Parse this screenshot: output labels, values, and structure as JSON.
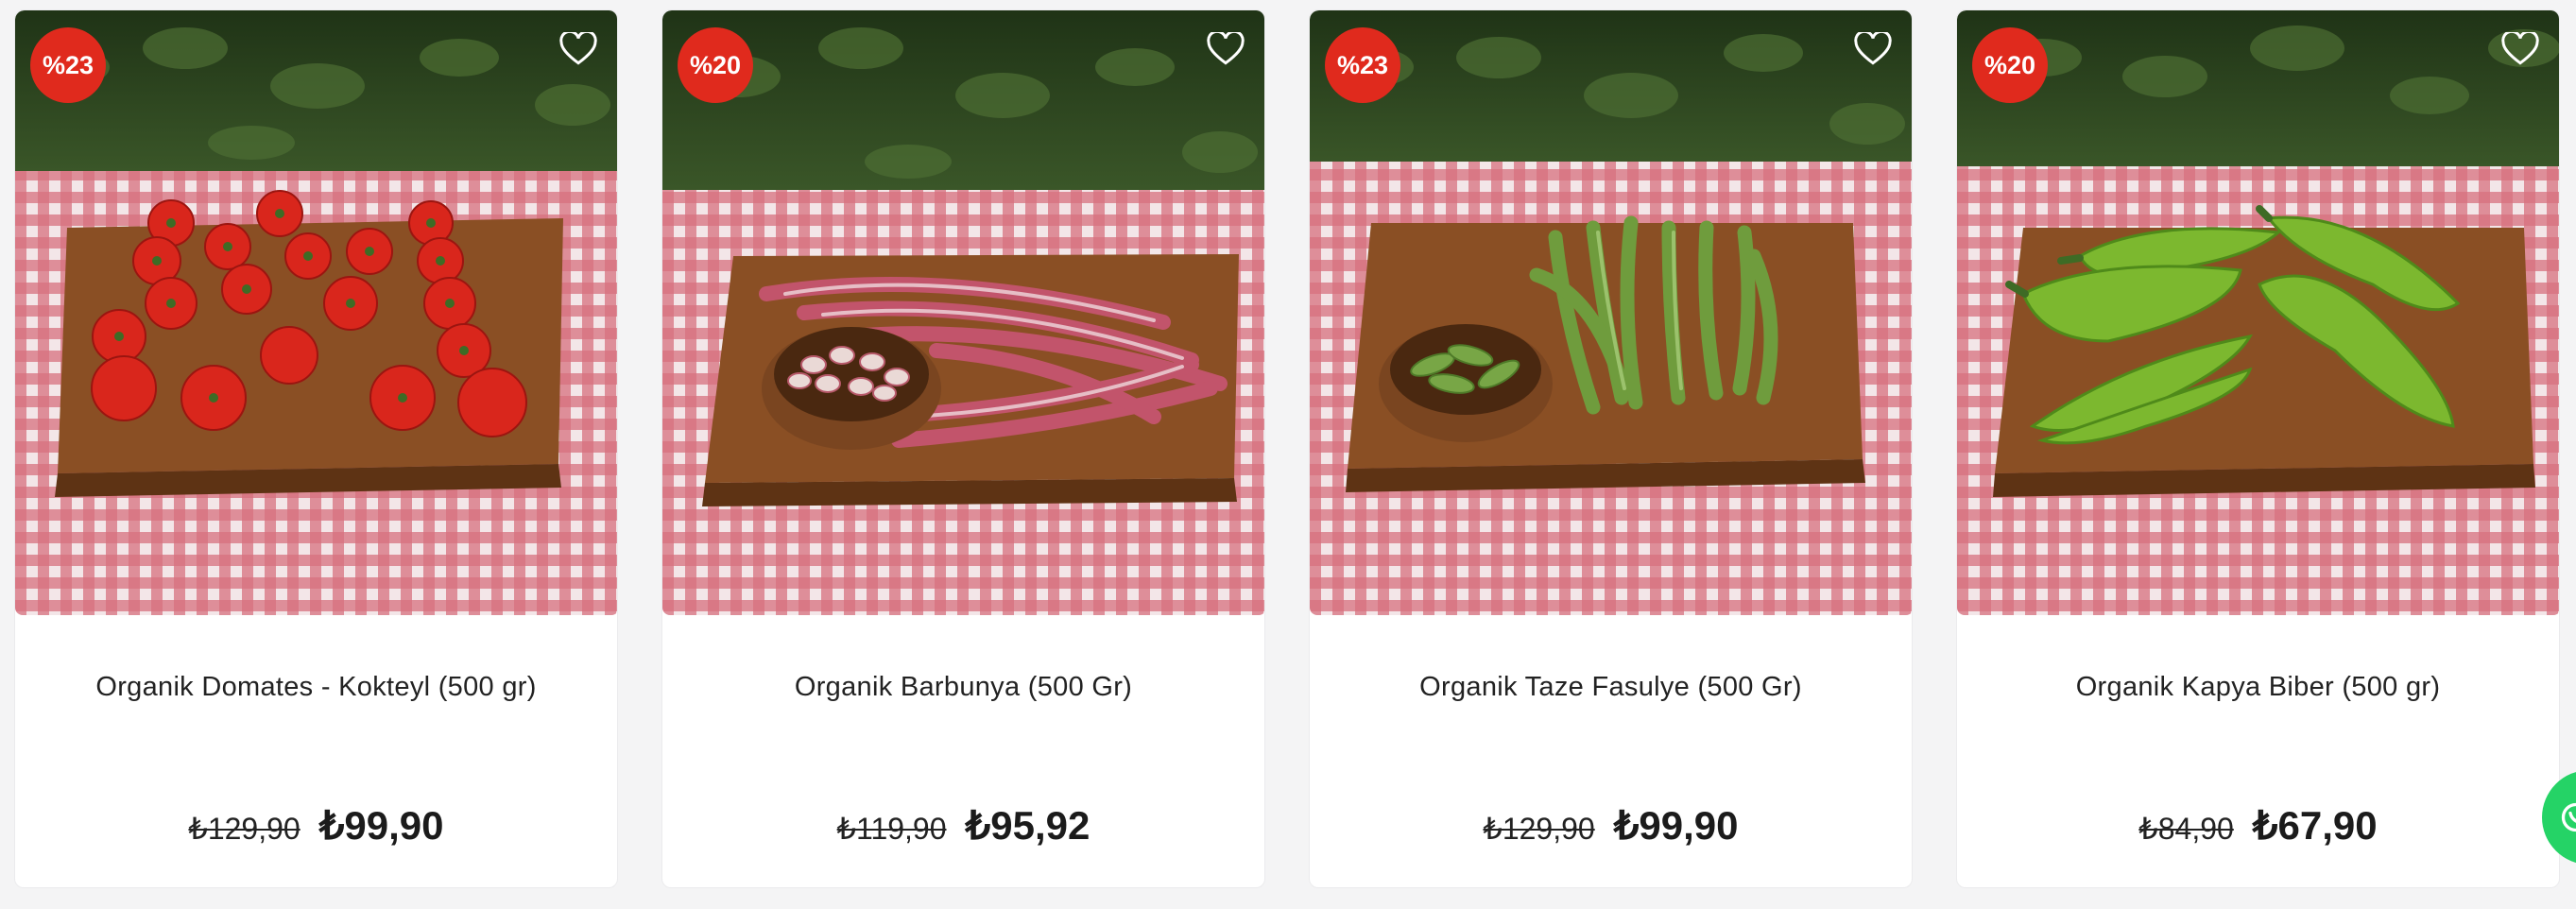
{
  "products": [
    {
      "discount": "%23",
      "title": "Organik Domates - Kokteyl (500 gr)",
      "old_price": "₺129,90",
      "new_price": "₺99,90",
      "image": "tomatoes"
    },
    {
      "discount": "%20",
      "title": "Organik Barbunya (500 Gr)",
      "old_price": "₺119,90",
      "new_price": "₺95,92",
      "image": "borlotti-beans"
    },
    {
      "discount": "%23",
      "title": "Organik Taze Fasulye (500 Gr)",
      "old_price": "₺129,90",
      "new_price": "₺99,90",
      "image": "green-beans"
    },
    {
      "discount": "%20",
      "title": "Organik Kapya Biber (500 gr)",
      "old_price": "₺84,90",
      "new_price": "₺67,90",
      "image": "green-peppers"
    }
  ],
  "icons": {
    "favorite": "heart-icon",
    "chat": "whatsapp-icon"
  },
  "colors": {
    "badge": "#e02a1d",
    "cloth_red": "#c8324a",
    "board_wood": "#8a4f24",
    "foliage": "#2f4a20"
  }
}
